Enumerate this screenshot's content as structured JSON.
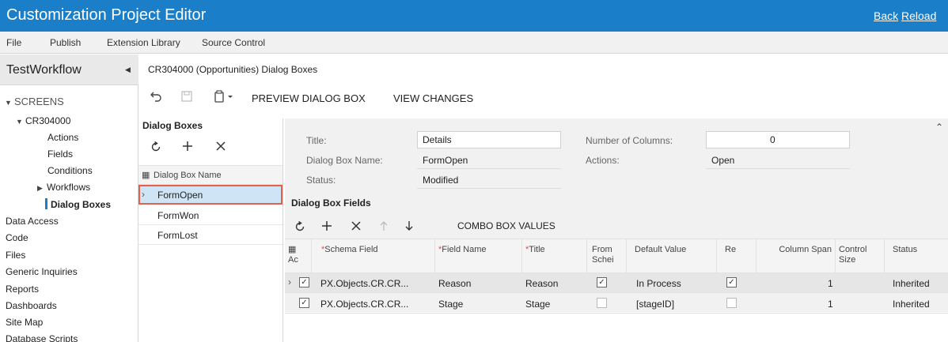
{
  "app": {
    "title": "Customization Project Editor",
    "back": "Back",
    "reload": "Reload"
  },
  "menu": [
    "File",
    "Publish",
    "Extension Library",
    "Source Control"
  ],
  "sidebar": {
    "project": "TestWorkflow",
    "items": [
      {
        "label": "SCREENS"
      },
      {
        "label": "CR304000"
      },
      {
        "label": "Actions"
      },
      {
        "label": "Fields"
      },
      {
        "label": "Conditions"
      },
      {
        "label": "Workflows"
      },
      {
        "label": "Dialog Boxes"
      },
      {
        "label": "Data Access"
      },
      {
        "label": "Code"
      },
      {
        "label": "Files"
      },
      {
        "label": "Generic Inquiries"
      },
      {
        "label": "Reports"
      },
      {
        "label": "Dashboards"
      },
      {
        "label": "Site Map"
      },
      {
        "label": "Database Scripts"
      }
    ]
  },
  "breadcrumb": "CR304000 (Opportunities) Dialog Boxes",
  "toolbar": {
    "preview": "PREVIEW DIALOG BOX",
    "view_changes": "VIEW CHANGES"
  },
  "dialog_boxes": {
    "title": "Dialog Boxes",
    "column": "Dialog Box Name",
    "rows": [
      "FormOpen",
      "FormWon",
      "FormLost"
    ]
  },
  "form": {
    "title_label": "Title:",
    "title_value": "Details",
    "name_label": "Dialog Box Name:",
    "name_value": "FormOpen",
    "status_label": "Status:",
    "status_value": "Modified",
    "columns_label": "Number of Columns:",
    "columns_value": "0",
    "actions_label": "Actions:",
    "actions_value": "Open"
  },
  "fields": {
    "title": "Dialog Box Fields",
    "combo_button": "COMBO BOX VALUES",
    "headers": {
      "active": "Ac",
      "schema_field": "Schema Field",
      "field_name": "Field Name",
      "title": "Title",
      "from_schema": "From Schei",
      "default_value": "Default Value",
      "required": "Re",
      "column_span": "Column Span",
      "control_size": "Control Size",
      "status": "Status"
    },
    "rows": [
      {
        "active": true,
        "schema_field": "PX.Objects.CR.CR...",
        "field_name": "Reason",
        "title": "Reason",
        "from_schema": true,
        "default_value": "In Process",
        "required": true,
        "column_span": "1",
        "status": "Inherited"
      },
      {
        "active": true,
        "schema_field": "PX.Objects.CR.CR...",
        "field_name": "Stage",
        "title": "Stage",
        "from_schema": false,
        "default_value": "[stageID]",
        "required": false,
        "column_span": "1",
        "status": "Inherited"
      }
    ]
  },
  "icons": {
    "undo": "undo-icon",
    "save": "save-icon",
    "clipboard": "clipboard-icon",
    "refresh": "refresh-icon",
    "add": "add-icon",
    "delete": "delete-icon",
    "up": "arrow-up-icon",
    "down": "arrow-down-icon"
  },
  "colors": {
    "brand": "#1a7fc8",
    "selected_row": "#cfe5f5",
    "selection_border": "#e4604a"
  }
}
